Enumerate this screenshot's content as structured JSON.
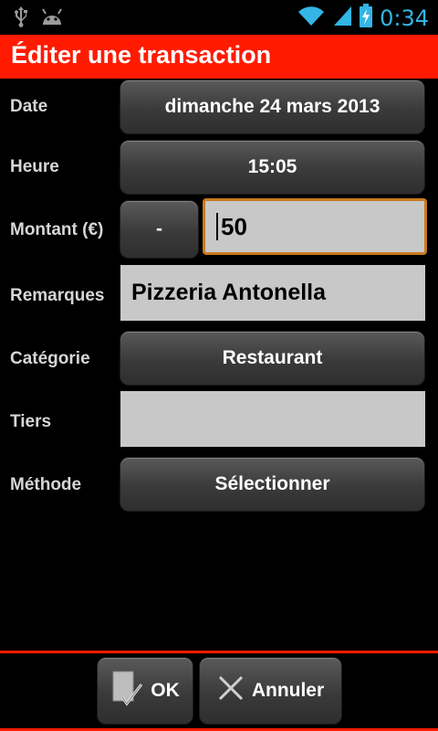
{
  "status_bar": {
    "time": "0:34",
    "icons": [
      "usb-icon",
      "android-icon",
      "wifi-icon",
      "signal-icon",
      "battery-charging-icon"
    ],
    "clock_color": "#33b5e5"
  },
  "header": {
    "title": "Éditer une transaction",
    "background": "#ff1a00"
  },
  "form": {
    "date": {
      "label": "Date",
      "value": "dimanche 24 mars 2013"
    },
    "time": {
      "label": "Heure",
      "value": "15:05"
    },
    "amount": {
      "label": "Montant (€)",
      "sign": "-",
      "value": "50"
    },
    "remarks": {
      "label": "Remarques",
      "value": "Pizzeria Antonella"
    },
    "category": {
      "label": "Catégorie",
      "value": "Restaurant"
    },
    "third_party": {
      "label": "Tiers",
      "value": ""
    },
    "method": {
      "label": "Méthode",
      "value": "Sélectionner"
    }
  },
  "actions": {
    "ok_label": "OK",
    "cancel_label": "Annuler"
  }
}
